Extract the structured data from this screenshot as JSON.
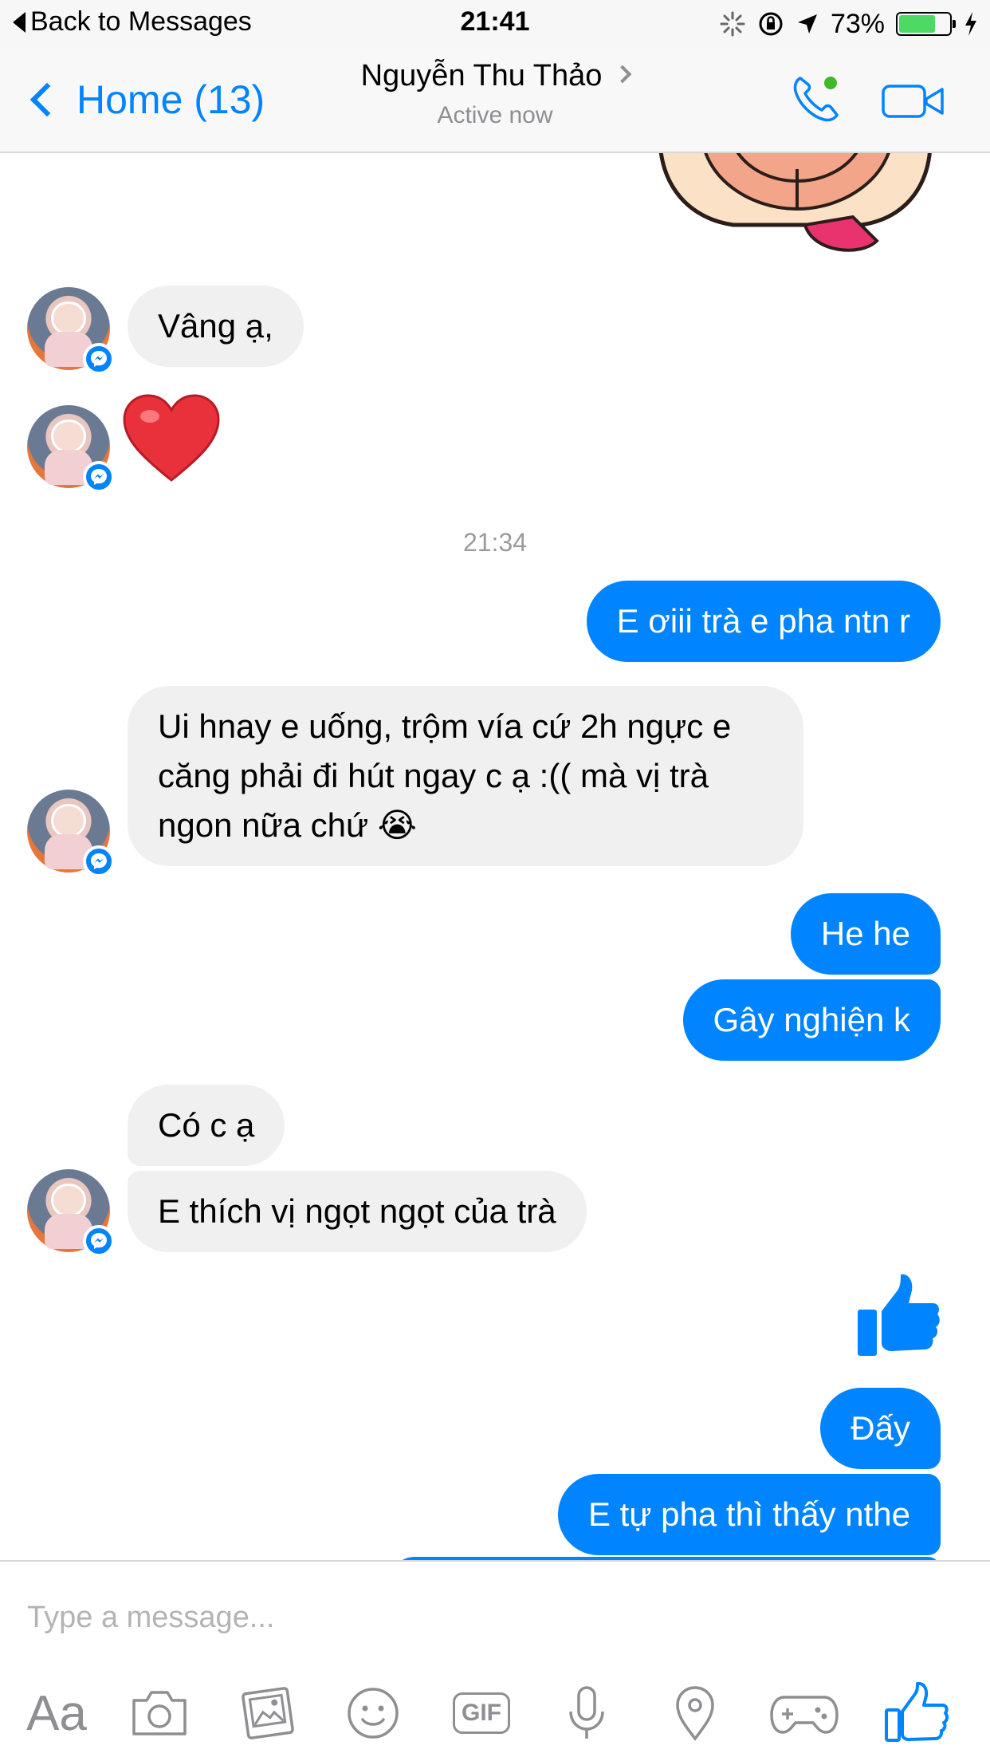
{
  "status_bar": {
    "back_label": "Back to Messages",
    "time": "21:41",
    "battery_percent": "73%",
    "battery_level": 0.73
  },
  "header": {
    "back_label": "Home (13)",
    "contact_name": "Nguyễn Thu Thảo",
    "status": "Active now",
    "accent_color": "#0084ff",
    "online_dot_color": "#42b72a"
  },
  "messages": {
    "m1": "Vâng ạ,",
    "m2_emoji": "❤️",
    "timestamp": "21:34",
    "m3": "E ơiii trà e pha ntn r",
    "m4": "Ui hnay e uống, trộm vía cứ 2h ngực e căng phải đi hút ngay c ạ :(( mà vị trà ngon nữa chứ 😭",
    "m5": "He he",
    "m6": "Gây nghiện k",
    "m7": "Có c ạ",
    "m8": "E thích vị ngọt ngọt của trà",
    "m9_icon": "thumbs-up-icon",
    "m10": "Đấy",
    "m11": "E tự pha thì thấy nthe"
  },
  "composer": {
    "placeholder": "Type a message...",
    "text_tool_label": "Aa",
    "gif_label": "GIF",
    "tools": [
      "text-format-icon",
      "camera-icon",
      "gallery-icon",
      "sticker-icon",
      "gif-icon",
      "microphone-icon",
      "location-icon",
      "game-icon",
      "thumbs-up-icon"
    ]
  },
  "colors": {
    "outgoing_bubble": "#0084ff",
    "incoming_bubble": "#f1f0f0",
    "heart": "#e8313b"
  }
}
